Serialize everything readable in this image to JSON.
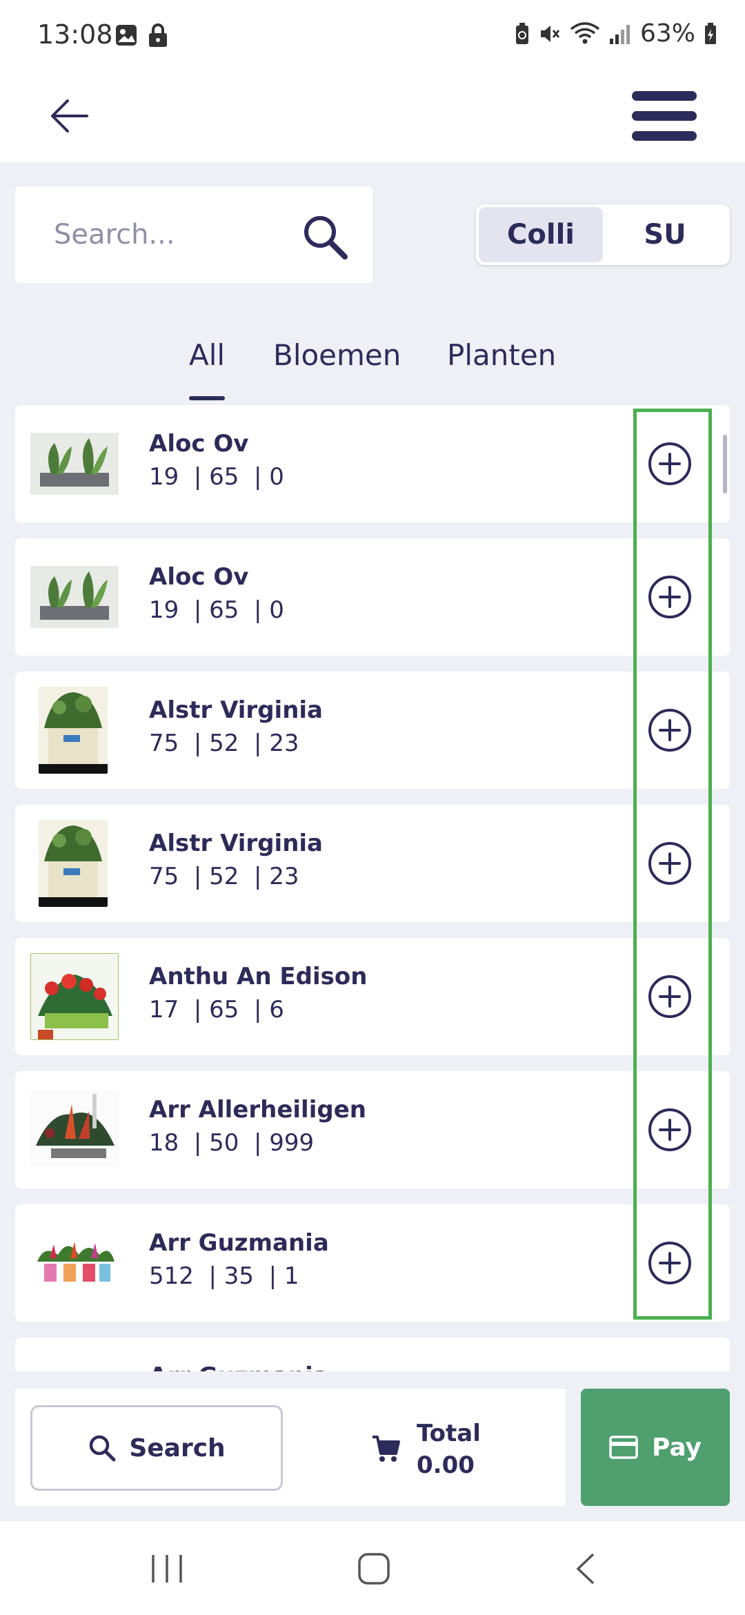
{
  "status": {
    "time": "13:08",
    "battery": "63%"
  },
  "search": {
    "placeholder": "Search..."
  },
  "toggle": {
    "options": [
      "Colli",
      "SU"
    ],
    "selected": "Colli"
  },
  "tabs": [
    "All",
    "Bloemen",
    "Planten"
  ],
  "selected_tab": "All",
  "products": [
    {
      "name": "Aloc Ov",
      "stats": "19  | 65  | 0"
    },
    {
      "name": "Aloc Ov",
      "stats": "19  | 65  | 0"
    },
    {
      "name": "Alstr Virginia",
      "stats": "75  | 52  | 23"
    },
    {
      "name": "Alstr Virginia",
      "stats": "75  | 52  | 23"
    },
    {
      "name": "Anthu An Edison",
      "stats": "17  | 65  | 6"
    },
    {
      "name": "Arr Allerheiligen",
      "stats": "18  | 50  | 999"
    },
    {
      "name": "Arr Guzmania",
      "stats": "512  | 35  | 1"
    },
    {
      "name": "Arr Guzmania",
      "stats": ""
    }
  ],
  "bottom": {
    "search_label": "Search",
    "total_label": "Total",
    "total_value": "0.00",
    "pay_label": "Pay"
  },
  "colors": {
    "primary": "#2d2b5a",
    "pay": "#4f9f6f",
    "highlight": "#4caf50",
    "background": "#eef0f6"
  }
}
